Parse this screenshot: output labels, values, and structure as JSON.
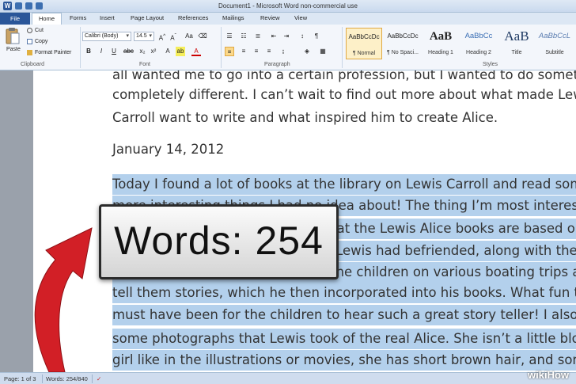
{
  "window": {
    "title": "Document1 - Microsoft Word non-commercial use"
  },
  "tabs": [
    "File",
    "Home",
    "Forms",
    "Insert",
    "Page Layout",
    "References",
    "Mailings",
    "Review",
    "View"
  ],
  "clipboard": {
    "paste": "Paste",
    "cut": "Cut",
    "copy": "Copy",
    "format_painter": "Format Painter",
    "group": "Clipboard"
  },
  "font": {
    "name": "Calibri (Body)",
    "size": "14.5",
    "group": "Font"
  },
  "paragraph": {
    "group": "Paragraph"
  },
  "styles": {
    "group": "Styles",
    "items": [
      {
        "preview": "AaBbCcDc",
        "name": "¶ Normal"
      },
      {
        "preview": "AaBbCcDc",
        "name": "¶ No Spaci..."
      },
      {
        "preview": "AaB",
        "name": "Heading 1"
      },
      {
        "preview": "AaBbCc",
        "name": "Heading 2"
      },
      {
        "preview": "AaB",
        "name": "Title"
      },
      {
        "preview": "AaBbCcL",
        "name": "Subtitle"
      }
    ]
  },
  "document": {
    "lines_top": [
      "all wanted me to go into a certain profession, but I wanted to do somethi",
      "completely different. I can’t wait to find out more about what made Lewi",
      "Carroll want to write and what inspired him to create Alice."
    ],
    "date": "January 14, 2012",
    "lines_selected": [
      "Today I found a lot of books at the library on Lewis Carroll and read some",
      "more interesting things I had no idea about! The thing I’m most intereste",
      "the real Alice that the Lewis Alice books are based on. She was a",
      "little girl whom Lewis had befriended, along with the",
      "He would take the children on various boating trips an",
      "tell them stories, which he then incorporated into his books. What fun th",
      "must have been for the children to hear such a great story teller! I also sa",
      "some photographs that Lewis took of the real Alice. She isn’t a little blon",
      "girl like in the illustrations or movies, she has short brown hair, and some"
    ]
  },
  "status": {
    "page": "Page: 1 of 3",
    "words": "Words: 254/840"
  },
  "callout": {
    "text": "Words: 254"
  },
  "watermark": "wikiHow",
  "colors": {
    "accent": "#2a5699",
    "selection": "#b3d0ec",
    "arrow": "#d21f26"
  }
}
